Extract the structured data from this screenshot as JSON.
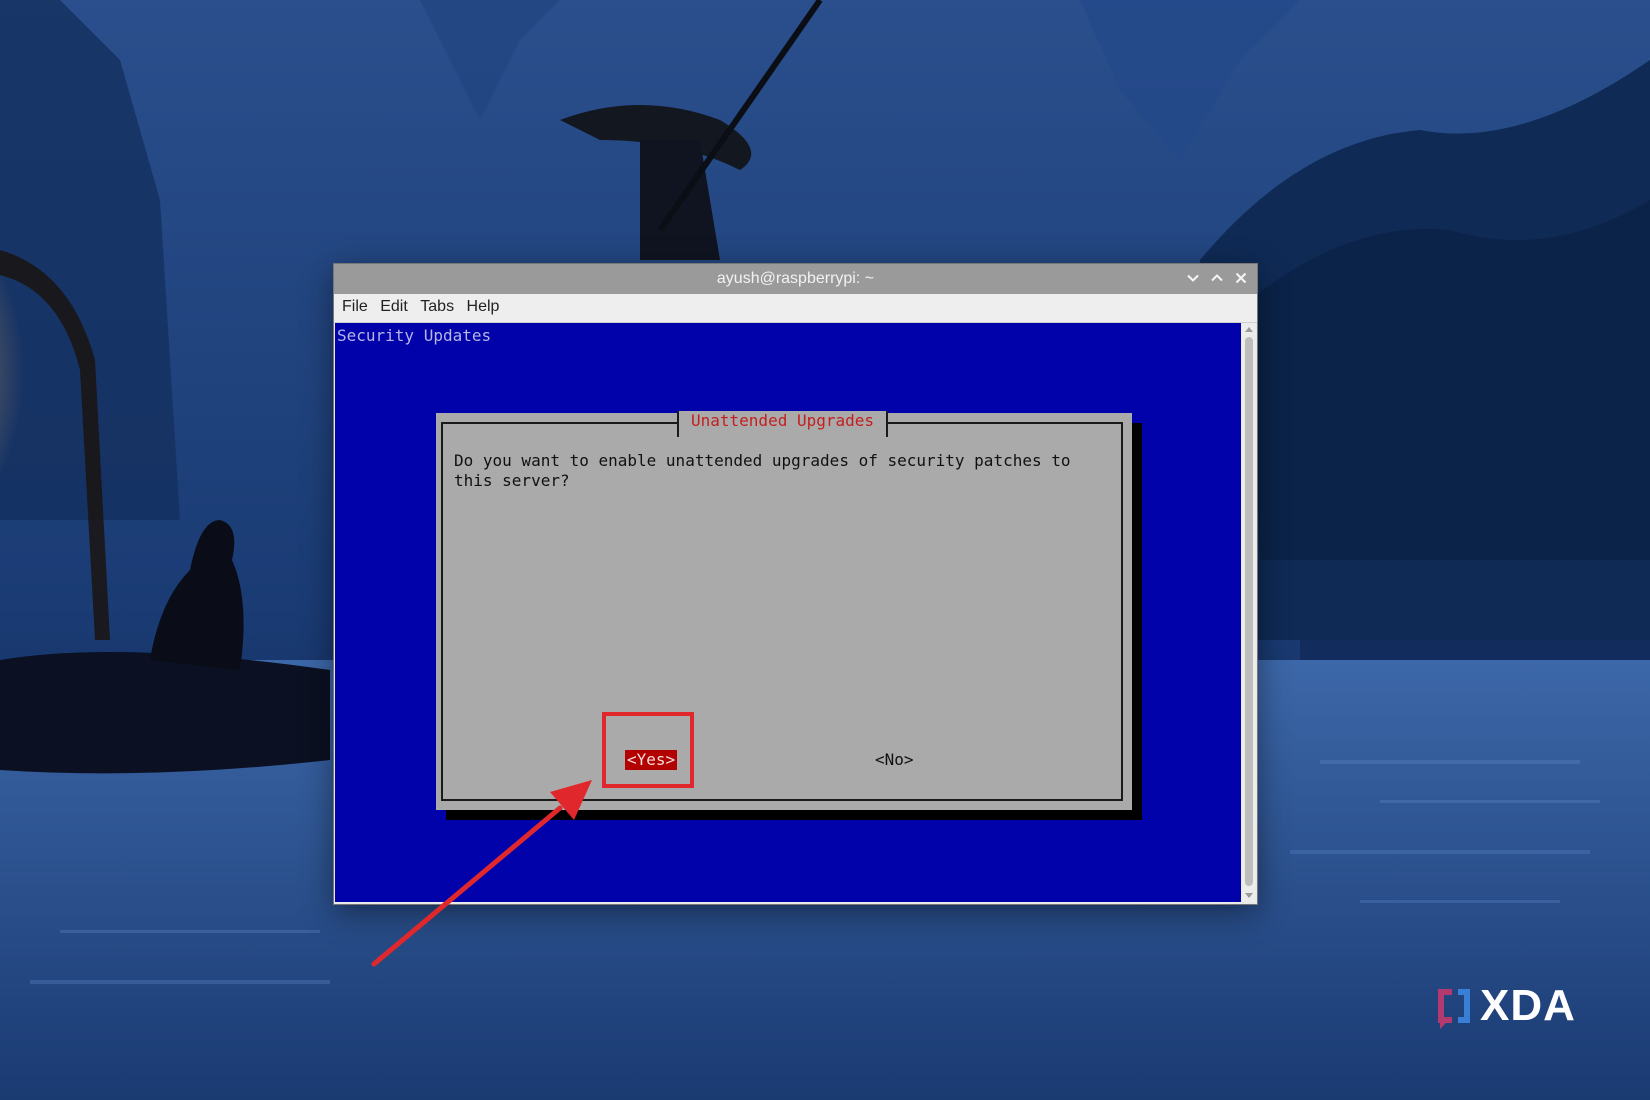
{
  "window": {
    "title": "ayush@raspberrypi: ~",
    "menu": [
      "File",
      "Edit",
      "Tabs",
      "Help"
    ]
  },
  "terminal": {
    "backtitle": "Security Updates",
    "dialog": {
      "title": "Unattended Upgrades",
      "message": "Do you want to enable unattended upgrades of security patches to\nthis server?",
      "yes_label": "<Yes>",
      "no_label": "<No>"
    }
  },
  "annotation": {
    "color": "#e0282c"
  },
  "watermark": {
    "text": "XDA"
  },
  "colors": {
    "terminal_bg": "#0202aa",
    "dialog_bg": "#aaaaaa",
    "dialog_title": "#c41e1e",
    "button_selected": "#b30000"
  }
}
